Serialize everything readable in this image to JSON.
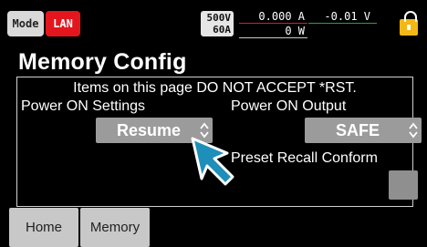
{
  "status": {
    "mode_label": "Mode",
    "connection_label": "LAN",
    "rating_voltage": "500V",
    "rating_current": "60A",
    "current_reading": "0.000 A",
    "voltage_reading": "-0.01 V",
    "power_reading": "0 W",
    "lock_icon": "lock-icon",
    "colors": {
      "lan": "#e4161d",
      "lock": "#f3b716",
      "current": "#d82020",
      "voltage": "#2aa04a"
    }
  },
  "page": {
    "title": "Memory Config",
    "notice": "Items on this page DO NOT ACCEPT *RST."
  },
  "settings": {
    "power_on_label": "Power ON Settings",
    "power_on_value": "Resume",
    "power_on_output_label": "Power ON Output",
    "power_on_output_value": "SAFE",
    "preset_recall_label": "Preset Recall Conform",
    "preset_recall_checked": false
  },
  "nav": {
    "home_label": "Home",
    "memory_label": "Memory"
  },
  "cursor_icon": "pointer-cursor-icon"
}
